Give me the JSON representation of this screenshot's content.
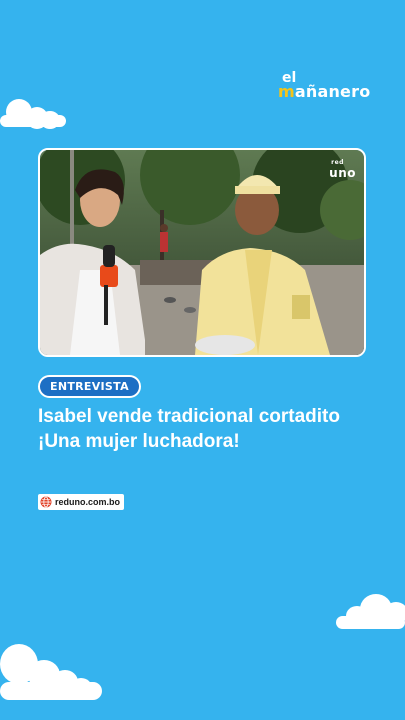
{
  "brand": {
    "top": "el",
    "word_part1": "m",
    "word_part2": "añanero"
  },
  "video": {
    "channel_label": "red",
    "channel_name": "uno"
  },
  "tag": {
    "label": "ENTREVISTA"
  },
  "headline": {
    "line1": "Isabel vende tradicional cortadito",
    "line2": "¡Una mujer luchadora!"
  },
  "source": {
    "site": "reduno.com.bo"
  },
  "colors": {
    "background": "#35b3ee",
    "pill": "#1d6fc4",
    "white": "#ffffff"
  },
  "icons": {
    "site_icon": "globe-icon"
  }
}
